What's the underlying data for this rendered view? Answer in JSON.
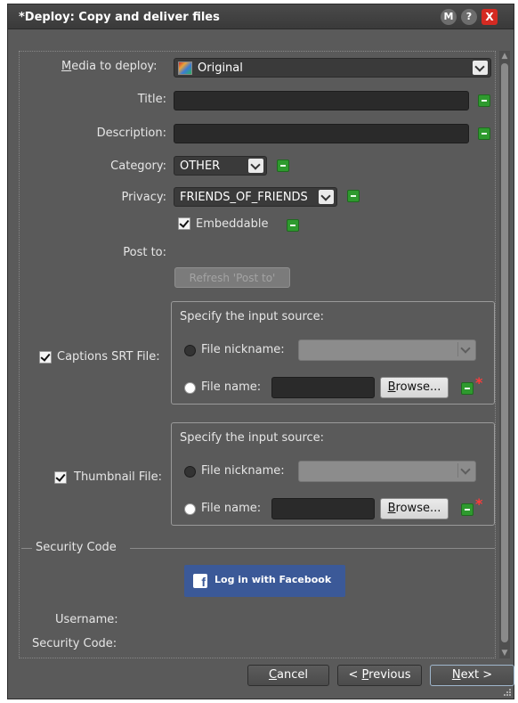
{
  "window": {
    "title": "*Deploy: Copy and deliver files",
    "buttons": {
      "m": "M",
      "help": "?",
      "close": "X"
    }
  },
  "media": {
    "label_prefix": "M",
    "label_rest": "edia to deploy:",
    "value": "Original"
  },
  "title_field": {
    "label": "Title:",
    "value": ""
  },
  "description_field": {
    "label": "Description:",
    "value": ""
  },
  "category": {
    "label": "Category:",
    "value": "OTHER"
  },
  "privacy": {
    "label": "Privacy:",
    "value": "FRIENDS_OF_FRIENDS"
  },
  "embeddable": {
    "label": "Embeddable",
    "checked": true
  },
  "post_to": {
    "label": "Post to:",
    "refresh_label": "Refresh 'Post to'"
  },
  "captions": {
    "label": "Captions SRT File:",
    "checked": true,
    "group_title": "Specify the input source:",
    "nickname_label": "File nickname:",
    "nickname_value": "",
    "filename_label": "File name:",
    "filename_value": "",
    "browse_prefix": "B",
    "browse_rest": "rowse...",
    "required_mark": "*"
  },
  "thumbnail": {
    "label": "Thumbnail File:",
    "checked": true,
    "group_title": "Specify the input source:",
    "nickname_label": "File nickname:",
    "nickname_value": "",
    "filename_label": "File name:",
    "filename_value": "",
    "browse_prefix": "B",
    "browse_rest": "rowse...",
    "required_mark": "*"
  },
  "security": {
    "section_title": "Security Code",
    "facebook_label": "Log in with Facebook",
    "facebook_icon": "f",
    "username_label": "Username:",
    "code_label": "Security Code:"
  },
  "footer": {
    "cancel_prefix": "C",
    "cancel_rest": "ancel",
    "previous_prefix": "< ",
    "previous_u": "P",
    "previous_rest": "revious",
    "next_u": "N",
    "next_rest": "ext >"
  },
  "colors": {
    "window_bg": "#5a5a5a",
    "field_bg": "#2a2a2a",
    "add_button": "#2e9a2e",
    "required": "#ff3b3b",
    "facebook": "#3b5998",
    "close_button": "#d42a22"
  }
}
